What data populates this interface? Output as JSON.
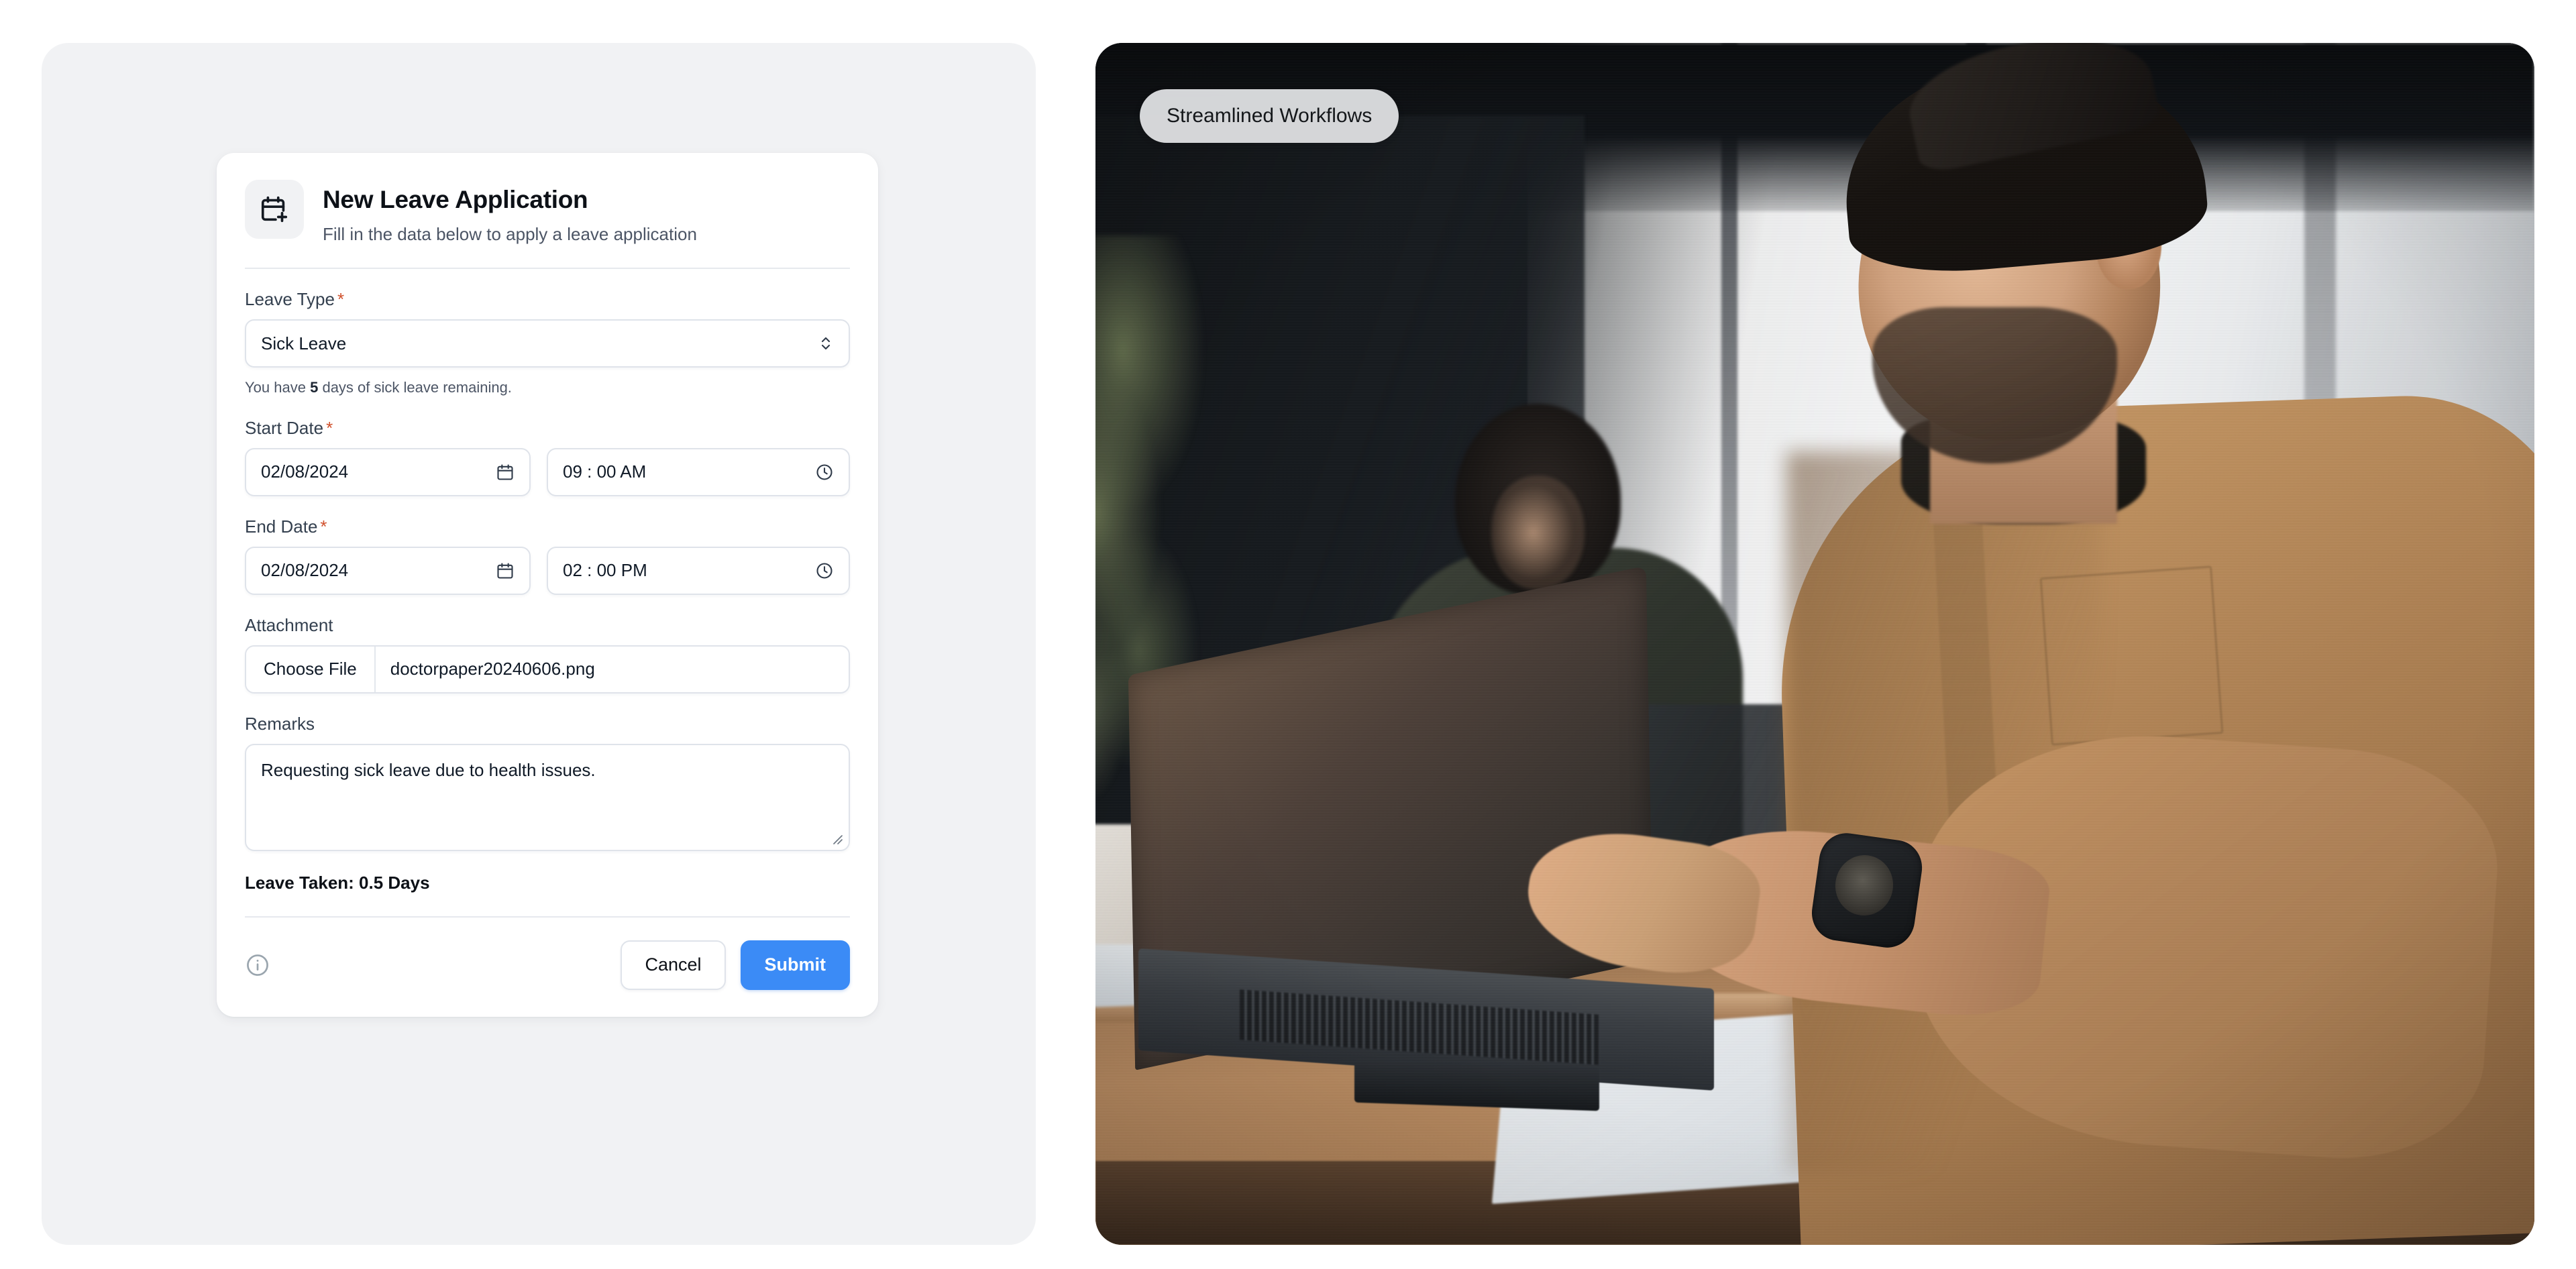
{
  "form_card": {
    "icon": "calendar-plus-icon",
    "title": "New Leave Application",
    "subtitle": "Fill in the data below to apply a leave application",
    "fields": {
      "leave_type": {
        "label": "Leave Type",
        "required_marker": "*",
        "value": "Sick Leave",
        "icon": "chevron-up-down-icon",
        "helper_prefix": "You have",
        "helper_value": "5",
        "helper_suffix": "days of sick leave remaining."
      },
      "start_date": {
        "label": "Start Date",
        "required_marker": "*",
        "date_value": "02/08/2024",
        "date_icon": "calendar-icon",
        "time_value": "09 : 00 AM",
        "time_icon": "clock-icon"
      },
      "end_date": {
        "label": "End Date",
        "required_marker": "*",
        "date_value": "02/08/2024",
        "date_icon": "calendar-icon",
        "time_value": "02 : 00 PM",
        "time_icon": "clock-icon"
      },
      "attachment": {
        "label": "Attachment",
        "button_label": "Choose File",
        "file_name": "doctorpaper20240606.png"
      },
      "remarks": {
        "label": "Remarks",
        "value": "Requesting sick leave due to health issues."
      }
    },
    "summary": "Leave Taken: 0.5 Days",
    "footer": {
      "info_icon": "info-circle-icon",
      "cancel_label": "Cancel",
      "submit_label": "Submit"
    }
  },
  "photo_panel": {
    "badge_label": "Streamlined Workflows",
    "scene_description": "Man in tan button-up shirt typing on a laptop at a wooden desk in a bright office, colleague working in the background"
  },
  "colors": {
    "page_background": "#ffffff",
    "left_panel_background": "#f1f2f4",
    "card_background": "#ffffff",
    "accent_blue": "#3b8bf6",
    "required_marker": "#d0502c",
    "text_primary": "#0d1117",
    "text_secondary": "#4c5565",
    "border": "#dfe3ea",
    "badge_background": "#e1e2e4"
  }
}
